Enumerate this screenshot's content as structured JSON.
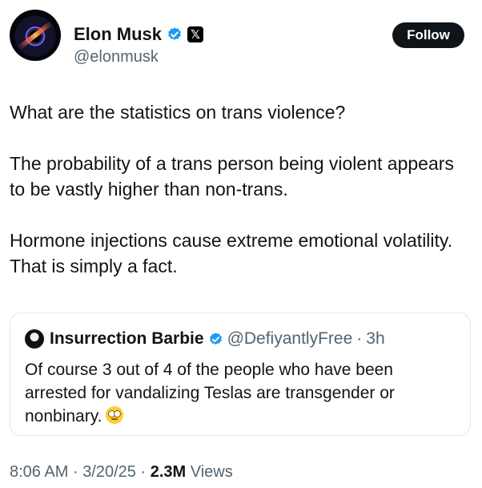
{
  "author": {
    "name": "Elon Musk",
    "handle": "@elonmusk",
    "verified_icon": "verified-badge-icon",
    "affiliation_icon": "x-logo-icon",
    "badge_color": "#1d9bf0"
  },
  "follow_button": {
    "label": "Follow"
  },
  "tweet": {
    "paragraphs": [
      "What are the statistics on trans violence?",
      "The probability of a trans person being violent appears to be vastly higher than non-trans.",
      "Hormone injections cause extreme emotional volatility. That is simply a fact."
    ]
  },
  "quoted_tweet": {
    "name": "Insurrection Barbie",
    "handle": "@DefiyantlyFree",
    "separator": "·",
    "time": "3h",
    "text": "Of course 3 out of 4 of the people who have been arrested for vandalizing Teslas are transgender or nonbinary.",
    "emoji": "face-with-rolling-eyes"
  },
  "meta": {
    "time": "8:06 AM",
    "separator": "·",
    "date": "3/20/25",
    "views_count": "2.3M",
    "views_label": "Views"
  }
}
